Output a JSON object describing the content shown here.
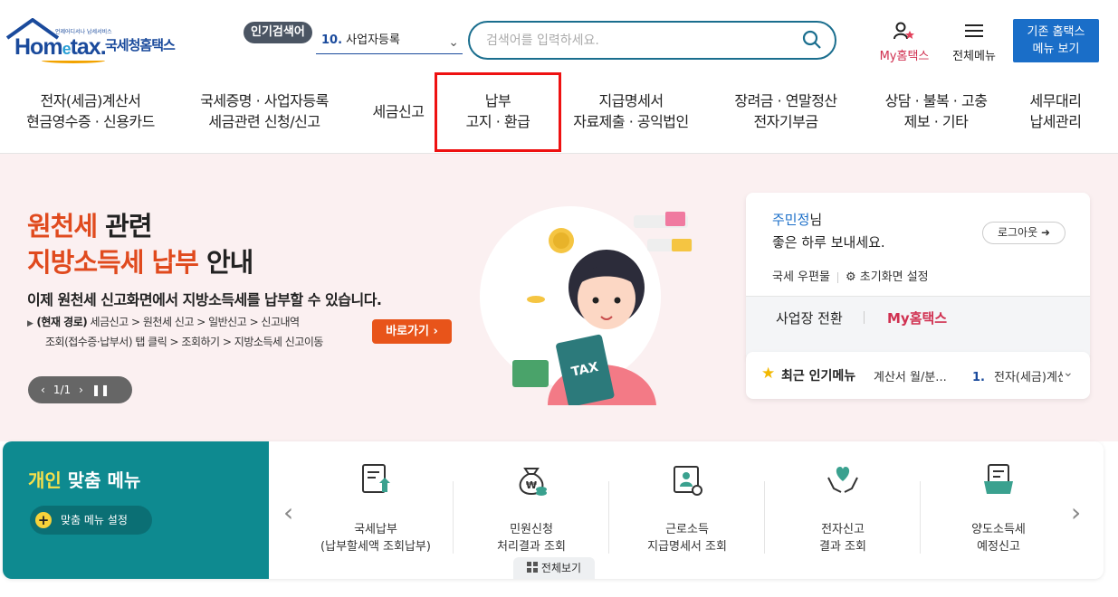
{
  "header": {
    "logo_brand_pre": "Hom",
    "logo_brand_e": "e",
    "logo_brand_post": "tax.",
    "logo_small": "언제어디서나 납세서비스",
    "logo_kor": "국세청홈택스",
    "popular_badge": "인기검색어",
    "popular_num": "10.",
    "popular_term": "사업자등록",
    "search_placeholder": "검색어를 입력하세요.",
    "my_hometax": "My홈택스",
    "all_menu": "전체메뉴",
    "old_home_line1": "기존 홈택스",
    "old_home_line2": "메뉴 보기"
  },
  "nav": [
    {
      "l1": "전자(세금)계산서",
      "l2": "현금영수증 · 신용카드"
    },
    {
      "l1": "국세증명 · 사업자등록",
      "l2": "세금관련 신청/신고"
    },
    {
      "l1": "세금신고",
      "l2": ""
    },
    {
      "l1": "납부",
      "l2": "고지 · 환급"
    },
    {
      "l1": "지급명세서",
      "l2": "자료제출 · 공익법인"
    },
    {
      "l1": "장려금 · 연말정산",
      "l2": "전자기부금"
    },
    {
      "l1": "상담 · 불복 · 고충",
      "l2": "제보 · 기타"
    },
    {
      "l1": "세무대리",
      "l2": "납세관리"
    }
  ],
  "hero": {
    "title_l1_red": "원천세",
    "title_l1_rest": " 관련",
    "title_l2_red": "지방소득세 납부",
    "title_l2_rest": " 안내",
    "desc": "이제 원천세 신고화면에서 지방소득세를 납부할 수 있습니다.",
    "route_label": "(현재 경로)",
    "route_l1": " 세금신고 > 원천세 신고 > 일반신고 > 신고내역",
    "route_l2": "조회(접수증·납부서) 탭 클릭 > 조회하기 > 지방소득세 신고이동",
    "goto_btn": "바로가기",
    "pager": "1/1",
    "tax_label": "TAX"
  },
  "login": {
    "user_name": "주민정",
    "name_suffix": "님",
    "greeting": "좋은 하루 보내세요.",
    "logout": "로그아웃",
    "mailbox": "국세 우편물",
    "home_settings": "초기화면 설정",
    "switch_biz": "사업장 전환",
    "my_hometax": "My홈택스"
  },
  "recent": {
    "title": "최근 인기메뉴",
    "item_prev": "계산서 월/분...",
    "item_num": "1.",
    "item_label": "전자(세금)계산서"
  },
  "custom_menu": {
    "title_y": "개인",
    "title_rest": " 맞춤 메뉴",
    "settings": "맞춤 메뉴 설정",
    "items": [
      {
        "l1": "국세납부",
        "l2": "(납부할세액 조회납부)"
      },
      {
        "l1": "민원신청",
        "l2": "처리결과 조회"
      },
      {
        "l1": "근로소득",
        "l2": "지급명세서 조회"
      },
      {
        "l1": "전자신고",
        "l2": "결과 조회"
      },
      {
        "l1": "양도소득세",
        "l2": "예정신고"
      }
    ],
    "view_all": "전체보기"
  }
}
